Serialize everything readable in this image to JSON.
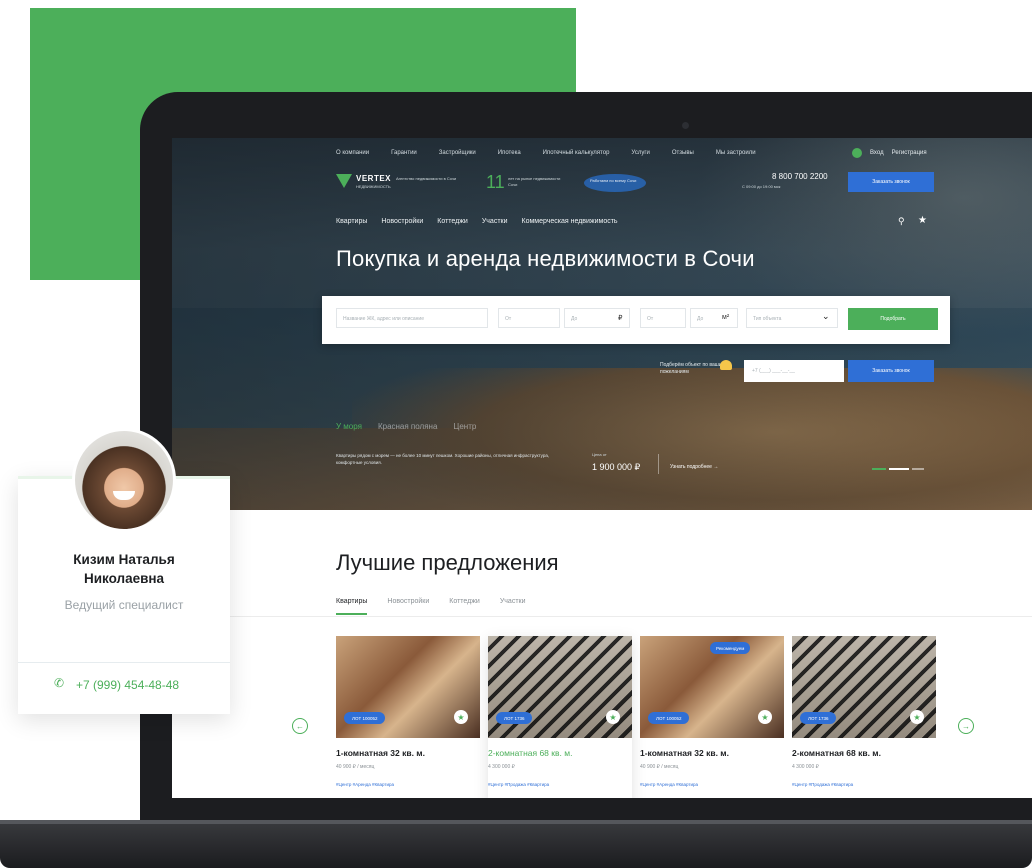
{
  "topnav": [
    "О компании",
    "Гарантии",
    "Застройщики",
    "Ипотека",
    "Ипотечный калькулятор",
    "Услуги",
    "Отзывы",
    "Мы застроили"
  ],
  "auth": {
    "login": "Вход",
    "register": "Регистрация"
  },
  "brand": {
    "logo": "VERTEX",
    "logo_sub": "НЕДВИЖИМОСТЬ",
    "tagline": "Агентство недвижимости в Сочи",
    "years": "11",
    "years_text": "лет на рынке недвижимости Сочи",
    "map_text": "Работаем по всему Сочи"
  },
  "contact": {
    "phone": "8 800 700 2200",
    "phone_sub": "С 09:00 до 19:00 мск",
    "callback": "Заказать звонок"
  },
  "catnav": [
    "Квартиры",
    "Новостройки",
    "Коттеджи",
    "Участки",
    "Коммерческая недвижимость"
  ],
  "hero": {
    "title": "Покупка и аренда недвижимости в Сочи",
    "search": {
      "keyword_placeholder": "Название ЖК, адрес или описание",
      "price_from": "От",
      "price_to": "До",
      "price_unit": "₽",
      "area_from": "От",
      "area_to": "До",
      "area_unit": "м²",
      "type_placeholder": "Тип объекта",
      "submit": "Подобрать"
    },
    "pick": {
      "label": "Подберём объект по вашим пожеланиям",
      "input_placeholder": "+7 (___) ___-__-__",
      "button": "Заказать звонок"
    },
    "districts": [
      "У моря",
      "Красная поляна",
      "Центр"
    ],
    "description": "Квартиры рядом с морем — не более 10 минут пешком. Хорошие районы, отличная инфраструктура, комфортные условия.",
    "price_caption": "Цена от",
    "price": "1 900 000 ₽",
    "more": "Узнать подробнее →"
  },
  "offers": {
    "title": "Лучшие предложения",
    "tabs": [
      "Квартиры",
      "Новостройки",
      "Коттеджи",
      "Участки"
    ],
    "cards": [
      {
        "lot": "ЛОТ 100052",
        "title": "1-комнатная 32 кв. м.",
        "price": "40 900 ₽ / месяц",
        "tags": "#Центр   #Аренда   #Квартира"
      },
      {
        "lot": "ЛОТ 1736",
        "title": "2-комнатная 68 кв. м.",
        "price": "4 300 000 ₽",
        "tags": "#Центр   #Продажа   #Квартира"
      },
      {
        "lot": "ЛОТ 100052",
        "rec": "Рекомендуем",
        "title": "1-комнатная 32 кв. м.",
        "price": "40 900 ₽ / месяц",
        "tags": "#Центр   #Аренда   #Квартира"
      },
      {
        "lot": "ЛОТ 1736",
        "title": "2-комнатная 68 кв. м.",
        "price": "4 300 000 ₽",
        "tags": "#Центр   #Продажа   #Квартира"
      }
    ]
  },
  "agent": {
    "name_line1": "Кизим Наталья",
    "name_line2": "Николаевна",
    "role": "Ведущий специалист",
    "phone": "+7 (999) 454-48-48"
  },
  "colors": {
    "accent": "#4caf5a",
    "blue": "#2f6fd6",
    "text": "#1d1f22"
  }
}
